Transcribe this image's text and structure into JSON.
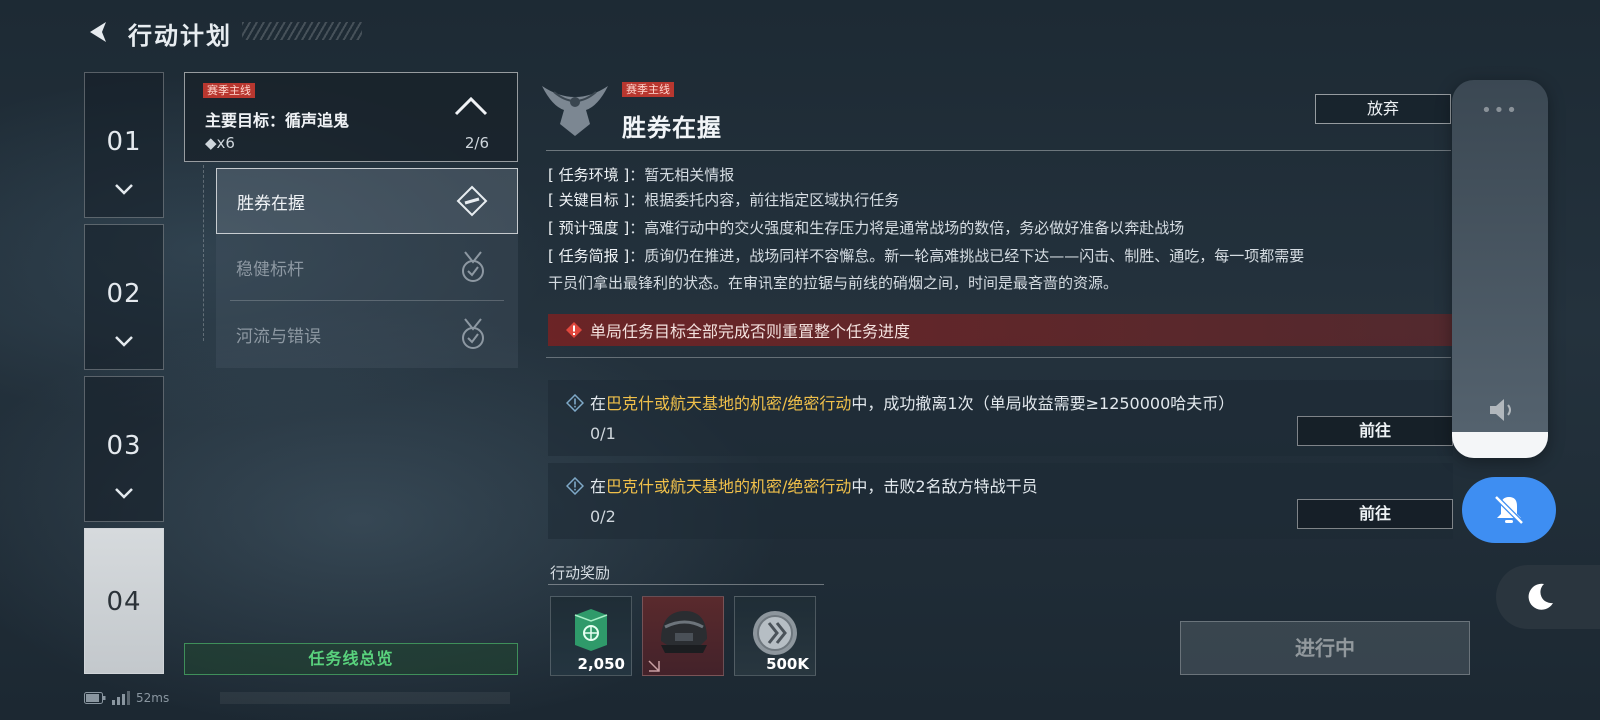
{
  "header": {
    "title": "行动计划"
  },
  "chapters": [
    {
      "num": "01",
      "active": false
    },
    {
      "num": "02",
      "active": false
    },
    {
      "num": "03",
      "active": false
    },
    {
      "num": "04",
      "active": true
    }
  ],
  "mission": {
    "tag": "赛季主线",
    "goal": "主要目标：循声追鬼",
    "reward_count": "◆x6",
    "progress": "2/6"
  },
  "sub_missions": [
    {
      "label": "胜券在握"
    },
    {
      "label": "稳健标杆"
    },
    {
      "label": "河流与错误"
    }
  ],
  "overview_button": "任务线总览",
  "detail": {
    "tag": "赛季主线",
    "title": "胜券在握",
    "abandon": "放弃",
    "info": [
      {
        "key": "[ 任务环境 ]",
        "value": "：暂无相关情报"
      },
      {
        "key": "[ 关键目标 ]",
        "value": "：根据委托内容，前往指定区域执行任务"
      },
      {
        "key": "[ 预计强度 ]",
        "value": "：高难行动中的交火强度和生存压力将是通常战场的数倍，务必做好准备以奔赴战场"
      },
      {
        "key": "[ 任务简报 ]",
        "value": "：质询仍在推进，战场同样不容懈怠。新一轮高难挑战已经下达——闪击、制胜、通吃，每一项都需要"
      }
    ],
    "briefing_cont": "干员们拿出最锋利的状态。在审讯室的拉锯与前线的硝烟之间，时间是最吝啬的资源。",
    "warning": "单局任务目标全部完成否则重置整个任务进度",
    "tasks": [
      {
        "pre": "在",
        "highlight": "巴克什或航天基地的机密/绝密行动",
        "post": "中，成功撤离1次（单局收益需要≥1250000哈夫币）",
        "progress": "0/1",
        "go": "前往"
      },
      {
        "pre": "在",
        "highlight": "巴克什或航天基地的机密/绝密行动",
        "post": "中，击败2名敌方特战干员",
        "progress": "0/2",
        "go": "前往"
      }
    ],
    "rewards_title": "行动奖励",
    "rewards": [
      {
        "icon": "green-crate-icon",
        "amount": "2,050"
      },
      {
        "icon": "helmet-icon",
        "amount": ""
      },
      {
        "icon": "coin-icon",
        "amount": "500K"
      }
    ],
    "status_button": "进行中"
  },
  "statusbar": {
    "ping": "52ms"
  },
  "colors": {
    "highlight": "#f0c04a",
    "green": "#59d27d",
    "warn": "#b8372f",
    "accent_blue": "#3e8ef2"
  }
}
